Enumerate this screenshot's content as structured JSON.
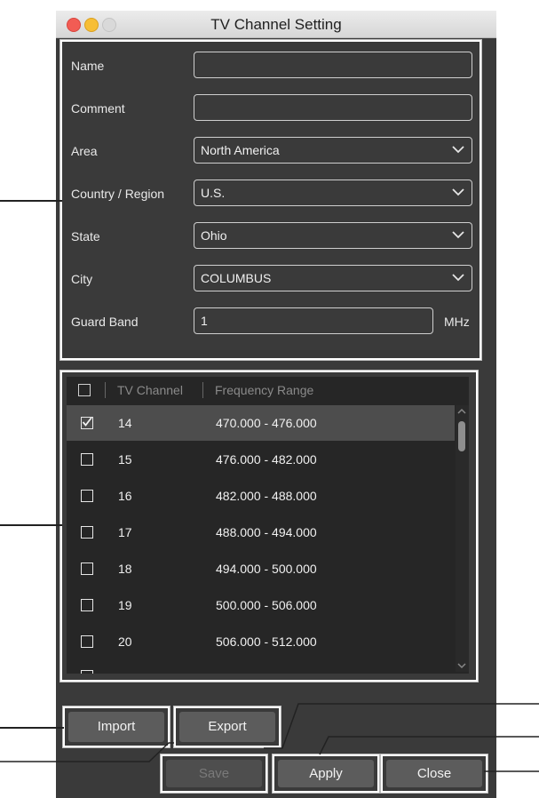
{
  "window": {
    "title": "TV Channel Setting"
  },
  "form": {
    "name": {
      "label": "Name",
      "value": ""
    },
    "comment": {
      "label": "Comment",
      "value": ""
    },
    "area": {
      "label": "Area",
      "value": "North America"
    },
    "country": {
      "label": "Country / Region",
      "value": "U.S."
    },
    "state": {
      "label": "State",
      "value": "Ohio"
    },
    "city": {
      "label": "City",
      "value": "COLUMBUS"
    },
    "guard_band": {
      "label": "Guard Band",
      "value": "1",
      "unit": "MHz"
    }
  },
  "table": {
    "headers": [
      "TV Channel",
      "Frequency Range"
    ],
    "rows": [
      {
        "channel": "14",
        "range": "470.000 - 476.000",
        "checked": true
      },
      {
        "channel": "15",
        "range": "476.000 - 482.000",
        "checked": false
      },
      {
        "channel": "16",
        "range": "482.000 - 488.000",
        "checked": false
      },
      {
        "channel": "17",
        "range": "488.000 - 494.000",
        "checked": false
      },
      {
        "channel": "18",
        "range": "494.000 - 500.000",
        "checked": false
      },
      {
        "channel": "19",
        "range": "500.000 - 506.000",
        "checked": false
      },
      {
        "channel": "20",
        "range": "506.000 - 512.000",
        "checked": false
      }
    ]
  },
  "buttons": {
    "import": "Import",
    "export": "Export",
    "save": "Save",
    "apply": "Apply",
    "close": "Close"
  }
}
